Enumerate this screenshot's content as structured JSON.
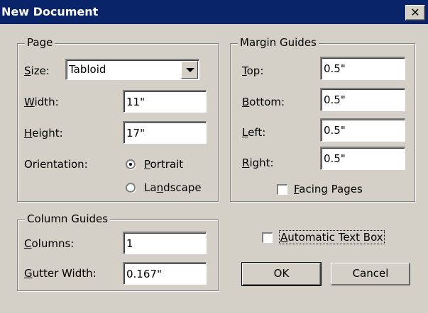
{
  "window": {
    "title": "New Document",
    "close_glyph": "✕"
  },
  "page_group": {
    "legend": "Page",
    "size": {
      "mnemonic": "S",
      "rest": "ize:",
      "value": "Tabloid"
    },
    "width": {
      "mnemonic": "W",
      "rest": "idth:",
      "value": "11\""
    },
    "height": {
      "mnemonic": "H",
      "rest": "eight:",
      "value": "17\""
    },
    "orientation": {
      "label": "Orientation:",
      "portrait": {
        "mnemonic": "P",
        "rest": "ortrait",
        "checked": true
      },
      "landscape": {
        "pre": "La",
        "mnemonic": "n",
        "rest": "dscape",
        "checked": false
      }
    }
  },
  "margin_group": {
    "legend": "Margin Guides",
    "top": {
      "mnemonic": "T",
      "rest": "op:",
      "value": "0.5\""
    },
    "bottom": {
      "mnemonic": "B",
      "rest": "ottom:",
      "value": "0.5\""
    },
    "left": {
      "mnemonic": "L",
      "rest": "eft:",
      "value": "0.5\""
    },
    "right": {
      "mnemonic": "R",
      "rest": "ight:",
      "value": "0.5\""
    },
    "facing_pages": {
      "mnemonic": "F",
      "rest": "acing Pages",
      "checked": false
    }
  },
  "column_group": {
    "legend": "Column Guides",
    "columns": {
      "mnemonic": "C",
      "rest": "olumns:",
      "value": "1"
    },
    "gutter": {
      "mnemonic": "G",
      "rest": "utter Width:",
      "value": "0.167\""
    }
  },
  "automatic_text_box": {
    "mnemonic": "A",
    "rest": "utomatic Text Box",
    "checked": false
  },
  "buttons": {
    "ok": "OK",
    "cancel": "Cancel"
  }
}
